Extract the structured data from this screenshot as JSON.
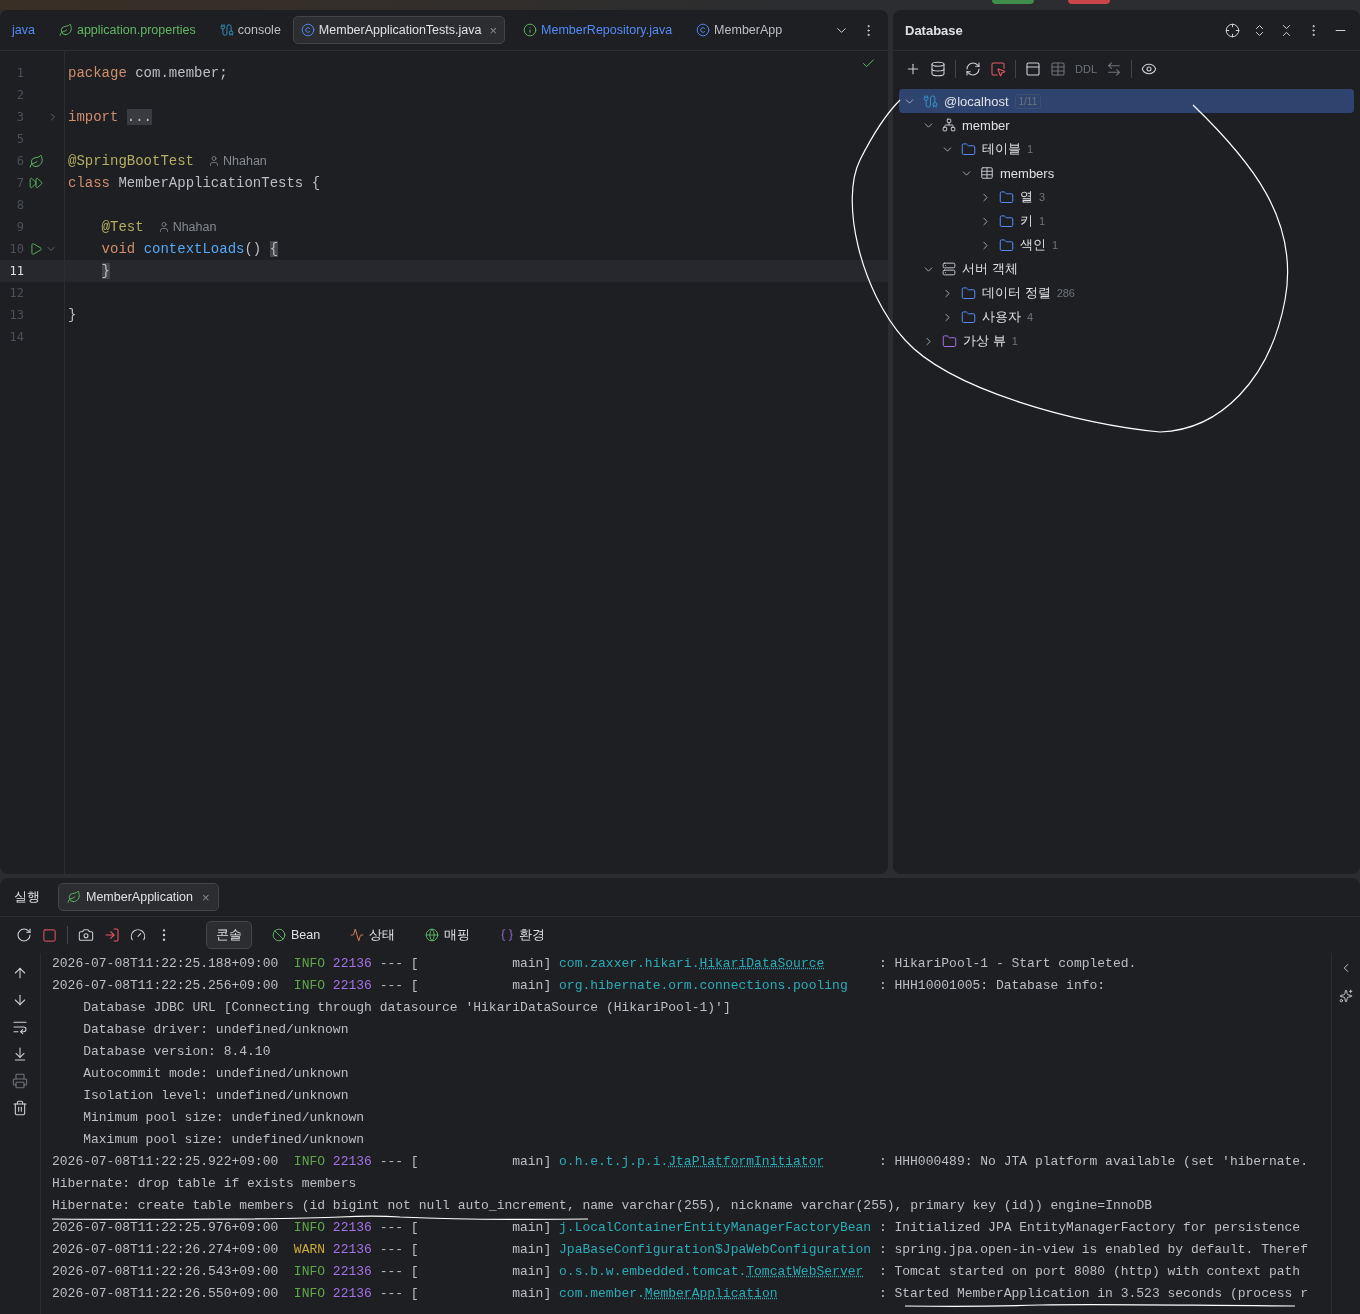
{
  "editor": {
    "tabs": [
      {
        "label": "java",
        "color": "#548af7",
        "selected": false
      },
      {
        "label": "application.properties",
        "kind": "spring",
        "color": "#5fb865",
        "selected": false
      },
      {
        "label": "console",
        "kind": "db",
        "color": "#bcbec4",
        "selected": false
      },
      {
        "label": "MemberApplicationTests.java",
        "kind": "class",
        "color": "#dfe1e5",
        "selected": true,
        "close": "×"
      },
      {
        "label": "MemberRepository.java",
        "kind": "interface",
        "color": "#548af7",
        "selected": false
      },
      {
        "label": "MemberApp",
        "kind": "springclass",
        "color": "#bcbec4",
        "selected": false
      }
    ],
    "lines": [
      {
        "num": "1",
        "current": false,
        "tokens": [
          {
            "t": "package",
            "kind": "kw"
          },
          {
            "t": " com.member;",
            "kind": "plain"
          }
        ]
      },
      {
        "num": "2",
        "current": false
      },
      {
        "num": "3",
        "current": false,
        "kind": "fold",
        "tokens": [
          {
            "t": "import ",
            "kind": "kw"
          },
          {
            "t": "...",
            "kind": "folded"
          }
        ]
      },
      {
        "num": "5",
        "current": false
      },
      {
        "num": "6",
        "current": false,
        "kind": "spring",
        "tokens": [
          {
            "t": "@SpringBootTest",
            "kind": "ann"
          }
        ],
        "author": "Nhahan"
      },
      {
        "num": "7",
        "current": false,
        "kind": "runall",
        "tokens": [
          {
            "t": "class",
            "kind": "kw"
          },
          {
            "t": " MemberApplicationTests {",
            "kind": "plain"
          }
        ]
      },
      {
        "num": "8",
        "current": false
      },
      {
        "num": "9",
        "current": false,
        "tokens": [
          {
            "t": "    @Test",
            "kind": "ann"
          }
        ],
        "author": "Nhahan"
      },
      {
        "num": "10",
        "current": false,
        "kind": "run",
        "tokens": [
          {
            "t": "    void",
            "kind": "kw"
          },
          {
            "t": " contextLoads",
            "kind": "fn"
          },
          {
            "t": "() ",
            "kind": "plain"
          },
          {
            "t": "{",
            "kind": "brace"
          }
        ]
      },
      {
        "num": "11",
        "current": true,
        "tokens": [
          {
            "t": "    }",
            "kind": "brace"
          }
        ]
      },
      {
        "num": "12",
        "current": false
      },
      {
        "num": "13",
        "current": false,
        "tokens": [
          {
            "t": "}",
            "kind": "plain"
          }
        ]
      },
      {
        "num": "14",
        "current": false
      }
    ]
  },
  "database": {
    "title": "Database",
    "toolbar_label": "DDL",
    "tree": [
      {
        "label": "@localhost",
        "kind": "connection",
        "badge": "1/11",
        "selected": true,
        "expanded": true,
        "children": [
          {
            "label": "member",
            "kind": "schema",
            "selected": false,
            "expanded": true,
            "children": [
              {
                "label": "테이블",
                "count": "1",
                "kind": "folder",
                "selected": false,
                "expanded": true,
                "children": [
                  {
                    "label": "members",
                    "kind": "table",
                    "selected": false,
                    "expanded": true,
                    "children": [
                      {
                        "label": "열",
                        "count": "3",
                        "kind": "folder",
                        "selected": false,
                        "expanded": false
                      },
                      {
                        "label": "키",
                        "count": "1",
                        "kind": "folder",
                        "selected": false,
                        "expanded": false
                      },
                      {
                        "label": "색인",
                        "count": "1",
                        "kind": "folder",
                        "selected": false,
                        "expanded": false
                      }
                    ]
                  }
                ]
              }
            ]
          },
          {
            "label": "서버 객체",
            "kind": "server",
            "selected": false,
            "expanded": true,
            "children": [
              {
                "label": "데이터 정렬",
                "count": "286",
                "kind": "folder",
                "selected": false,
                "expanded": false
              },
              {
                "label": "사용자",
                "count": "4",
                "kind": "folder",
                "selected": false,
                "expanded": false
              }
            ]
          },
          {
            "label": "가상 뷰",
            "count": "1",
            "kind": "vfolder",
            "selected": false,
            "expanded": false
          }
        ]
      }
    ]
  },
  "run": {
    "title": "실행",
    "tab": {
      "label": "MemberApplication",
      "close": "×"
    },
    "views": [
      {
        "label": "콘솔",
        "selected": true
      },
      {
        "label": "Bean",
        "kind": "bean",
        "selected": false
      },
      {
        "label": "상태",
        "kind": "health",
        "selected": false
      },
      {
        "label": "매핑",
        "kind": "mapping",
        "selected": false
      },
      {
        "label": "환경",
        "kind": "env",
        "selected": false
      }
    ],
    "console": [
      {
        "kind": "log",
        "timestamp": "2026-07-08T11:22:25.188+09:00",
        "level": "INFO",
        "pid": "22136",
        "sep": "--- [",
        "thread": "main]",
        "logger": "com.zaxxer.hikari.",
        "logger_link": "HikariDataSource",
        "colon": ":",
        "message": "HikariPool-1 - Start completed."
      },
      {
        "kind": "log",
        "timestamp": "2026-07-08T11:22:25.256+09:00",
        "level": "INFO",
        "pid": "22136",
        "sep": "--- [",
        "thread": "main]",
        "logger": "org.hibernate.orm.connections.pooling",
        "colon": ":",
        "message": "HHH10001005: Database info:"
      },
      {
        "kind": "detail",
        "text": "Database JDBC URL [Connecting through datasource 'HikariDataSource (HikariPool-1)']"
      },
      {
        "kind": "detail",
        "text": "Database driver: undefined/unknown"
      },
      {
        "kind": "detail",
        "text": "Database version: 8.4.10"
      },
      {
        "kind": "detail",
        "text": "Autocommit mode: undefined/unknown"
      },
      {
        "kind": "detail",
        "text": "Isolation level: undefined/unknown"
      },
      {
        "kind": "detail",
        "text": "Minimum pool size: undefined/unknown"
      },
      {
        "kind": "detail",
        "text": "Maximum pool size: undefined/unknown"
      },
      {
        "kind": "log",
        "timestamp": "2026-07-08T11:22:25.922+09:00",
        "level": "INFO",
        "pid": "22136",
        "sep": "--- [",
        "thread": "main]",
        "logger": "o.h.e.t.j.p.i.",
        "logger_link": "JtaPlatformInitiator",
        "colon": ":",
        "message": "HHH000489: No JTA platform available (set 'hibernate."
      },
      {
        "kind": "plain",
        "text": "Hibernate: drop table if exists members"
      },
      {
        "kind": "plain",
        "text": "Hibernate: create table members (id bigint not null auto_increment, name varchar(255), nickname varchar(255), primary key (id)) engine=InnoDB"
      },
      {
        "kind": "log",
        "timestamp": "2026-07-08T11:22:25.976+09:00",
        "level": "INFO",
        "pid": "22136",
        "sep": "--- [",
        "thread": "main]",
        "logger": "j.LocalContainerEntityManagerFactoryBean",
        "colon": ":",
        "message": "Initialized JPA EntityManagerFactory for persistence"
      },
      {
        "kind": "log",
        "timestamp": "2026-07-08T11:22:26.274+09:00",
        "level": "WARN",
        "pid": "22136",
        "sep": "--- [",
        "thread": "main]",
        "logger": "JpaBaseConfiguration$JpaWebConfiguration",
        "colon": ":",
        "message": "spring.jpa.open-in-view is enabled by default. Theref"
      },
      {
        "kind": "log",
        "timestamp": "2026-07-08T11:22:26.543+09:00",
        "level": "INFO",
        "pid": "22136",
        "sep": "--- [",
        "thread": "main]",
        "logger": "o.s.b.w.embedded.tomcat.",
        "logger_link": "TomcatWebServer",
        "colon": ":",
        "message": "Tomcat started on port 8080 (http) with context path"
      },
      {
        "kind": "log",
        "timestamp": "2026-07-08T11:22:26.550+09:00",
        "level": "INFO",
        "pid": "22136",
        "sep": "--- [",
        "thread": "main]",
        "logger": "com.member.",
        "logger_link": "MemberApplication",
        "colon": ":",
        "message": "Started MemberApplication in 3.523 seconds (process r"
      }
    ]
  }
}
